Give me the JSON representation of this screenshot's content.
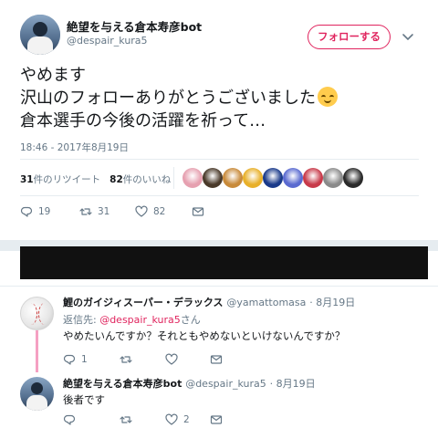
{
  "main_tweet": {
    "display_name": "絶望を与える倉本寿彦bot",
    "handle": "@despair_kura5",
    "follow_label": "フォローする",
    "text_lines": [
      "やめます",
      "沢山のフォローありがとうございました",
      "倉本選手の今後の活躍を祈って…"
    ],
    "emoji_icon": "relieved-face-emoji",
    "timestamp": "18:46 - 2017年8月19日",
    "retweet_count": "31",
    "retweet_label": "件のリツイート",
    "like_count": "82",
    "like_label": "件のいいね",
    "actions": {
      "reply_count": "19",
      "retweet_count": "31",
      "like_count": "82"
    },
    "liker_colors": [
      "#e6a0b0",
      "#4a3a2a",
      "#c88a3a",
      "#e8b02a",
      "#1a3a8a",
      "#5a6ad0",
      "#c83a4a",
      "#8a8a8a",
      "#2a2a2a"
    ]
  },
  "reply_1": {
    "display_name": "鯉のガイジィスーパー・デラックス",
    "handle": "@yamattomasa",
    "date": "· 8月19日",
    "reply_to_prefix": "返信先: ",
    "reply_to_handle": "@despair_kura5",
    "reply_to_suffix": "さん",
    "text": "やめたいんですか？それともやめないといけないんですか？",
    "reply_count": "1",
    "retweet_count": "",
    "like_count": ""
  },
  "reply_2": {
    "display_name": "絶望を与える倉本寿彦bot",
    "handle": "@despair_kura5",
    "date": "· 8月19日",
    "text": "後者です",
    "reply_count": "",
    "retweet_count": "",
    "like_count": "2"
  },
  "colors": {
    "accent_pink": "#e0245e",
    "muted_text": "#657786",
    "thread_line": "#f5a0c2"
  }
}
